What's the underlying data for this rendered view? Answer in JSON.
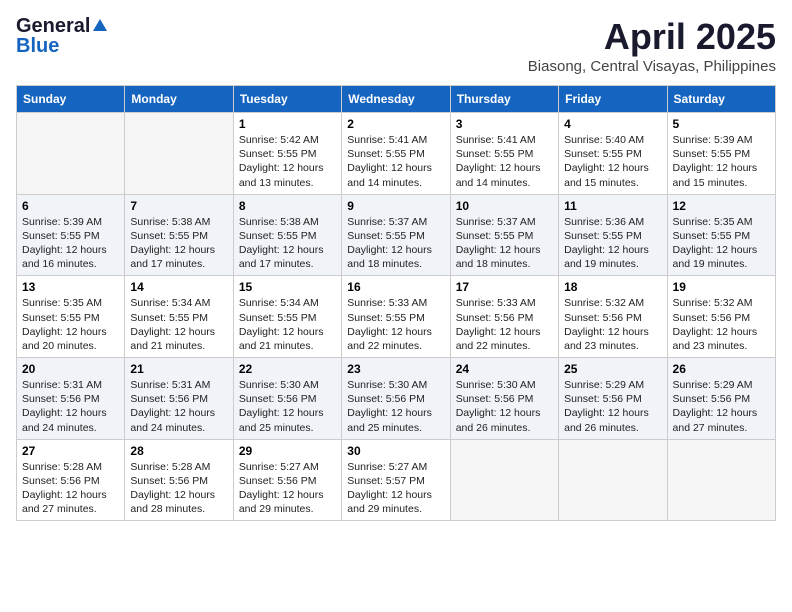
{
  "logo": {
    "general": "General",
    "blue": "Blue"
  },
  "title": "April 2025",
  "location": "Biasong, Central Visayas, Philippines",
  "headers": [
    "Sunday",
    "Monday",
    "Tuesday",
    "Wednesday",
    "Thursday",
    "Friday",
    "Saturday"
  ],
  "weeks": [
    [
      {
        "day": "",
        "sunrise": "",
        "sunset": "",
        "daylight": ""
      },
      {
        "day": "",
        "sunrise": "",
        "sunset": "",
        "daylight": ""
      },
      {
        "day": "1",
        "sunrise": "Sunrise: 5:42 AM",
        "sunset": "Sunset: 5:55 PM",
        "daylight": "Daylight: 12 hours and 13 minutes."
      },
      {
        "day": "2",
        "sunrise": "Sunrise: 5:41 AM",
        "sunset": "Sunset: 5:55 PM",
        "daylight": "Daylight: 12 hours and 14 minutes."
      },
      {
        "day": "3",
        "sunrise": "Sunrise: 5:41 AM",
        "sunset": "Sunset: 5:55 PM",
        "daylight": "Daylight: 12 hours and 14 minutes."
      },
      {
        "day": "4",
        "sunrise": "Sunrise: 5:40 AM",
        "sunset": "Sunset: 5:55 PM",
        "daylight": "Daylight: 12 hours and 15 minutes."
      },
      {
        "day": "5",
        "sunrise": "Sunrise: 5:39 AM",
        "sunset": "Sunset: 5:55 PM",
        "daylight": "Daylight: 12 hours and 15 minutes."
      }
    ],
    [
      {
        "day": "6",
        "sunrise": "Sunrise: 5:39 AM",
        "sunset": "Sunset: 5:55 PM",
        "daylight": "Daylight: 12 hours and 16 minutes."
      },
      {
        "day": "7",
        "sunrise": "Sunrise: 5:38 AM",
        "sunset": "Sunset: 5:55 PM",
        "daylight": "Daylight: 12 hours and 17 minutes."
      },
      {
        "day": "8",
        "sunrise": "Sunrise: 5:38 AM",
        "sunset": "Sunset: 5:55 PM",
        "daylight": "Daylight: 12 hours and 17 minutes."
      },
      {
        "day": "9",
        "sunrise": "Sunrise: 5:37 AM",
        "sunset": "Sunset: 5:55 PM",
        "daylight": "Daylight: 12 hours and 18 minutes."
      },
      {
        "day": "10",
        "sunrise": "Sunrise: 5:37 AM",
        "sunset": "Sunset: 5:55 PM",
        "daylight": "Daylight: 12 hours and 18 minutes."
      },
      {
        "day": "11",
        "sunrise": "Sunrise: 5:36 AM",
        "sunset": "Sunset: 5:55 PM",
        "daylight": "Daylight: 12 hours and 19 minutes."
      },
      {
        "day": "12",
        "sunrise": "Sunrise: 5:35 AM",
        "sunset": "Sunset: 5:55 PM",
        "daylight": "Daylight: 12 hours and 19 minutes."
      }
    ],
    [
      {
        "day": "13",
        "sunrise": "Sunrise: 5:35 AM",
        "sunset": "Sunset: 5:55 PM",
        "daylight": "Daylight: 12 hours and 20 minutes."
      },
      {
        "day": "14",
        "sunrise": "Sunrise: 5:34 AM",
        "sunset": "Sunset: 5:55 PM",
        "daylight": "Daylight: 12 hours and 21 minutes."
      },
      {
        "day": "15",
        "sunrise": "Sunrise: 5:34 AM",
        "sunset": "Sunset: 5:55 PM",
        "daylight": "Daylight: 12 hours and 21 minutes."
      },
      {
        "day": "16",
        "sunrise": "Sunrise: 5:33 AM",
        "sunset": "Sunset: 5:55 PM",
        "daylight": "Daylight: 12 hours and 22 minutes."
      },
      {
        "day": "17",
        "sunrise": "Sunrise: 5:33 AM",
        "sunset": "Sunset: 5:56 PM",
        "daylight": "Daylight: 12 hours and 22 minutes."
      },
      {
        "day": "18",
        "sunrise": "Sunrise: 5:32 AM",
        "sunset": "Sunset: 5:56 PM",
        "daylight": "Daylight: 12 hours and 23 minutes."
      },
      {
        "day": "19",
        "sunrise": "Sunrise: 5:32 AM",
        "sunset": "Sunset: 5:56 PM",
        "daylight": "Daylight: 12 hours and 23 minutes."
      }
    ],
    [
      {
        "day": "20",
        "sunrise": "Sunrise: 5:31 AM",
        "sunset": "Sunset: 5:56 PM",
        "daylight": "Daylight: 12 hours and 24 minutes."
      },
      {
        "day": "21",
        "sunrise": "Sunrise: 5:31 AM",
        "sunset": "Sunset: 5:56 PM",
        "daylight": "Daylight: 12 hours and 24 minutes."
      },
      {
        "day": "22",
        "sunrise": "Sunrise: 5:30 AM",
        "sunset": "Sunset: 5:56 PM",
        "daylight": "Daylight: 12 hours and 25 minutes."
      },
      {
        "day": "23",
        "sunrise": "Sunrise: 5:30 AM",
        "sunset": "Sunset: 5:56 PM",
        "daylight": "Daylight: 12 hours and 25 minutes."
      },
      {
        "day": "24",
        "sunrise": "Sunrise: 5:30 AM",
        "sunset": "Sunset: 5:56 PM",
        "daylight": "Daylight: 12 hours and 26 minutes."
      },
      {
        "day": "25",
        "sunrise": "Sunrise: 5:29 AM",
        "sunset": "Sunset: 5:56 PM",
        "daylight": "Daylight: 12 hours and 26 minutes."
      },
      {
        "day": "26",
        "sunrise": "Sunrise: 5:29 AM",
        "sunset": "Sunset: 5:56 PM",
        "daylight": "Daylight: 12 hours and 27 minutes."
      }
    ],
    [
      {
        "day": "27",
        "sunrise": "Sunrise: 5:28 AM",
        "sunset": "Sunset: 5:56 PM",
        "daylight": "Daylight: 12 hours and 27 minutes."
      },
      {
        "day": "28",
        "sunrise": "Sunrise: 5:28 AM",
        "sunset": "Sunset: 5:56 PM",
        "daylight": "Daylight: 12 hours and 28 minutes."
      },
      {
        "day": "29",
        "sunrise": "Sunrise: 5:27 AM",
        "sunset": "Sunset: 5:56 PM",
        "daylight": "Daylight: 12 hours and 29 minutes."
      },
      {
        "day": "30",
        "sunrise": "Sunrise: 5:27 AM",
        "sunset": "Sunset: 5:57 PM",
        "daylight": "Daylight: 12 hours and 29 minutes."
      },
      {
        "day": "",
        "sunrise": "",
        "sunset": "",
        "daylight": ""
      },
      {
        "day": "",
        "sunrise": "",
        "sunset": "",
        "daylight": ""
      },
      {
        "day": "",
        "sunrise": "",
        "sunset": "",
        "daylight": ""
      }
    ]
  ]
}
